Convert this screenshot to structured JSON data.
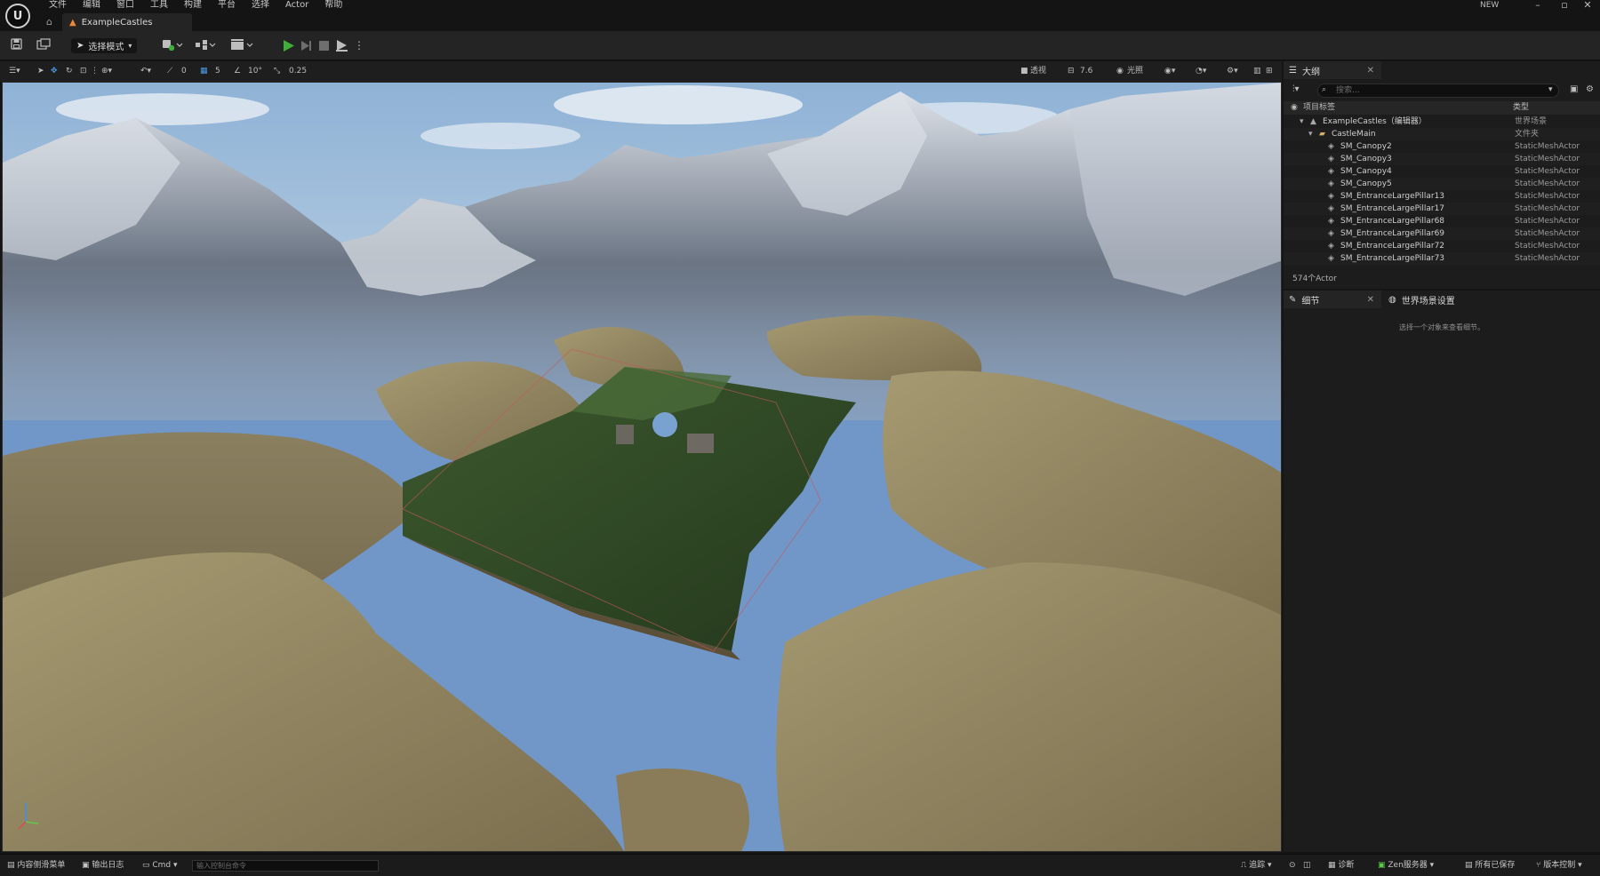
{
  "window": {
    "level_tab_name": "ExampleCastles",
    "new_badge": "NEW",
    "minimize": "–",
    "maximize": "▫",
    "close": "✕"
  },
  "menu": [
    "文件",
    "编辑",
    "窗口",
    "工具",
    "构建",
    "平台",
    "选择",
    "Actor",
    "帮助"
  ],
  "toolbar": {
    "mode_label": "选择模式",
    "icons": [
      "save-icon",
      "content-browser-icon",
      "add-actor-icon",
      "blueprint-icon",
      "cinematics-icon",
      "play-icon",
      "step-icon",
      "stop-icon",
      "eject-icon",
      "more-icon"
    ]
  },
  "viewport_toolbar": {
    "translate_snap": "0",
    "grid_snap": "5",
    "rotation_snap": "10°",
    "scale_snap": "0.25",
    "perspective_label": "透视",
    "lit_label": "光照",
    "camera_speed": "7.6"
  },
  "outliner": {
    "tab_title": "大纲",
    "search_placeholder": "搜索...",
    "col_label": "项目标签",
    "col_type": "类型",
    "rows": [
      {
        "name": "ExampleCastles（编辑器）",
        "type": "世界场景",
        "indent": 1
      },
      {
        "name": "CastleMain",
        "type": "文件夹",
        "indent": 2
      },
      {
        "name": "SM_Canopy2",
        "type": "StaticMeshActor",
        "indent": 3
      },
      {
        "name": "SM_Canopy3",
        "type": "StaticMeshActor",
        "indent": 3
      },
      {
        "name": "SM_Canopy4",
        "type": "StaticMeshActor",
        "indent": 3
      },
      {
        "name": "SM_Canopy5",
        "type": "StaticMeshActor",
        "indent": 3
      },
      {
        "name": "SM_EntranceLargePillar13",
        "type": "StaticMeshActor",
        "indent": 3
      },
      {
        "name": "SM_EntranceLargePillar17",
        "type": "StaticMeshActor",
        "indent": 3
      },
      {
        "name": "SM_EntranceLargePillar68",
        "type": "StaticMeshActor",
        "indent": 3
      },
      {
        "name": "SM_EntranceLargePillar69",
        "type": "StaticMeshActor",
        "indent": 3
      },
      {
        "name": "SM_EntranceLargePillar72",
        "type": "StaticMeshActor",
        "indent": 3
      },
      {
        "name": "SM_EntranceLargePillar73",
        "type": "StaticMeshActor",
        "indent": 3
      }
    ],
    "actor_count": "574个Actor"
  },
  "details": {
    "tab_details": "细节",
    "tab_world_settings": "世界场景设置",
    "empty_message": "选择一个对象来查看细节。"
  },
  "statusbar": {
    "content_drawer": "内容侧滑菜单",
    "output_log": "输出日志",
    "cmd": "Cmd",
    "console_placeholder": "输入控制台命令",
    "trace": "追踪",
    "derived_data": "诊断",
    "zen_server": "Zen服务器",
    "all_saved": "所有已保存",
    "source_control": "版本控制"
  },
  "colors": {
    "accent_play": "#3fae3a",
    "level_icon": "#e8883a"
  }
}
